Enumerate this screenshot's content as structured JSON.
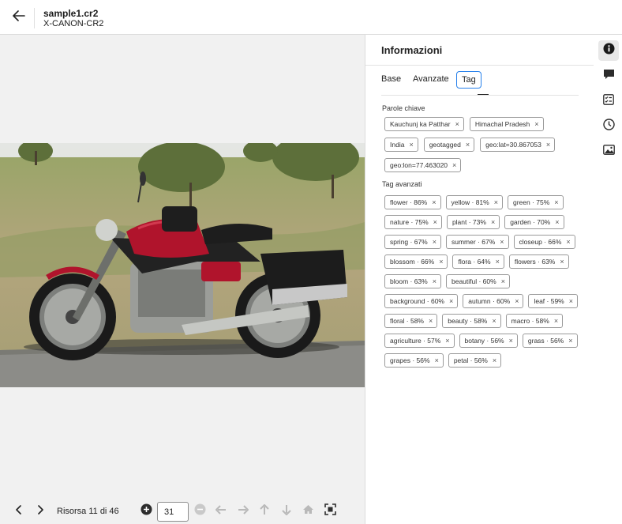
{
  "header": {
    "file_name": "sample1.cr2",
    "file_type": "X-CANON-CR2"
  },
  "viewer": {
    "image_alt": "motorcycle"
  },
  "bottom_bar": {
    "resource_count": "Risorsa 11 di 46",
    "zoom_value": "31"
  },
  "panel": {
    "title": "Informazioni",
    "tabs": [
      {
        "label": "Base"
      },
      {
        "label": "Avanzate"
      },
      {
        "label": "Tag"
      }
    ],
    "active_tab": "Tag",
    "keywords_label": "Parole chiave",
    "keywords": [
      "Kauchunj ka Patthar",
      "Himachal Pradesh",
      "India",
      "geotagged",
      "geo:lat=30.867053",
      "geo:lon=77.463020"
    ],
    "advanced_label": "Tag avanzati",
    "advanced_tags": [
      "flower · 86%",
      "yellow · 81%",
      "green · 75%",
      "nature · 75%",
      "plant · 73%",
      "garden · 70%",
      "spring · 67%",
      "summer · 67%",
      "closeup · 66%",
      "blossom · 66%",
      "flora · 64%",
      "flowers · 63%",
      "bloom · 63%",
      "beautiful · 60%",
      "background · 60%",
      "autumn · 60%",
      "leaf · 59%",
      "floral · 58%",
      "beauty · 58%",
      "macro · 58%",
      "agriculture · 57%",
      "botany · 56%",
      "grass · 56%",
      "grapes · 56%",
      "petal · 56%"
    ],
    "remove_glyph": "×"
  },
  "rail": {
    "icons": [
      "info-icon",
      "comment-icon",
      "checklist-icon",
      "history-icon",
      "image-icon"
    ],
    "active": "info-icon"
  },
  "colors": {
    "accent": "#2680eb",
    "viewer_bg": "#f1f1f1",
    "motorcycle_red": "#b0142c"
  }
}
